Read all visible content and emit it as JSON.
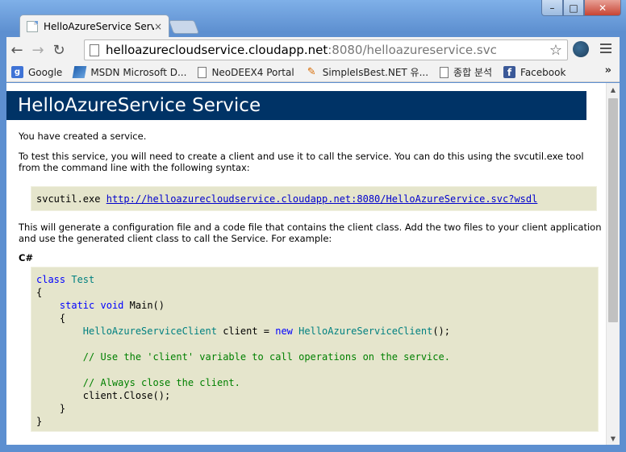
{
  "browser": {
    "tab": {
      "title": "HelloAzureService Service",
      "close": "×"
    },
    "window_buttons": {
      "minimize": "–",
      "maximize": "□",
      "close": "✕"
    },
    "nav": {
      "back": "←",
      "forward": "→",
      "reload": "↻"
    },
    "address": {
      "host": "helloazurecloudservice.cloudapp.net",
      "rest": ":8080/helloazureservice.svc"
    },
    "bookmarks": [
      {
        "label": "Google",
        "icon": "google-icon"
      },
      {
        "label": "MSDN Microsoft D...",
        "icon": "msdn-icon"
      },
      {
        "label": "NeoDEEX4 Portal",
        "icon": "page-icon"
      },
      {
        "label": "SimpleIsBest.NET 유...",
        "icon": "pen-icon"
      },
      {
        "label": "종합 분석",
        "icon": "page-icon"
      },
      {
        "label": "Facebook",
        "icon": "facebook-icon"
      }
    ],
    "bookmarks_more": "»"
  },
  "page": {
    "header": "HelloAzureService Service",
    "p1": "You have created a service.",
    "p2_line1": "To test this service, you will need to create a client and use it to call the service. You can do this using the svcutil.exe tool",
    "p2_line2": "from the command line with the following syntax:",
    "svcutil_cmd": "svcutil.exe",
    "svcutil_link": "http://helloazurecloudservice.cloudapp.net:8080/HelloAzureService.svc?wsdl",
    "p3_line1": "This will generate a configuration file and a code file that contains the client class. Add the two files to your client application",
    "p3_line2": "and use the generated client class to call the Service. For example:",
    "csharp_label": "C#",
    "code": {
      "kw_class": "class",
      "class_name": "Test",
      "open_brace": "{",
      "kw_static": "static",
      "kw_void": "void",
      "main": "Main()",
      "inner_open": "{",
      "client_type": "HelloAzureServiceClient",
      "client_assign": " client = ",
      "kw_new": "new",
      "client_ctor": "HelloAzureServiceClient",
      "ctor_end": "();",
      "comment1": "// Use the 'client' variable to call operations on the service.",
      "comment2": "// Always close the client.",
      "close_call": "client.Close();",
      "inner_close": "}",
      "close_brace": "}"
    }
  }
}
